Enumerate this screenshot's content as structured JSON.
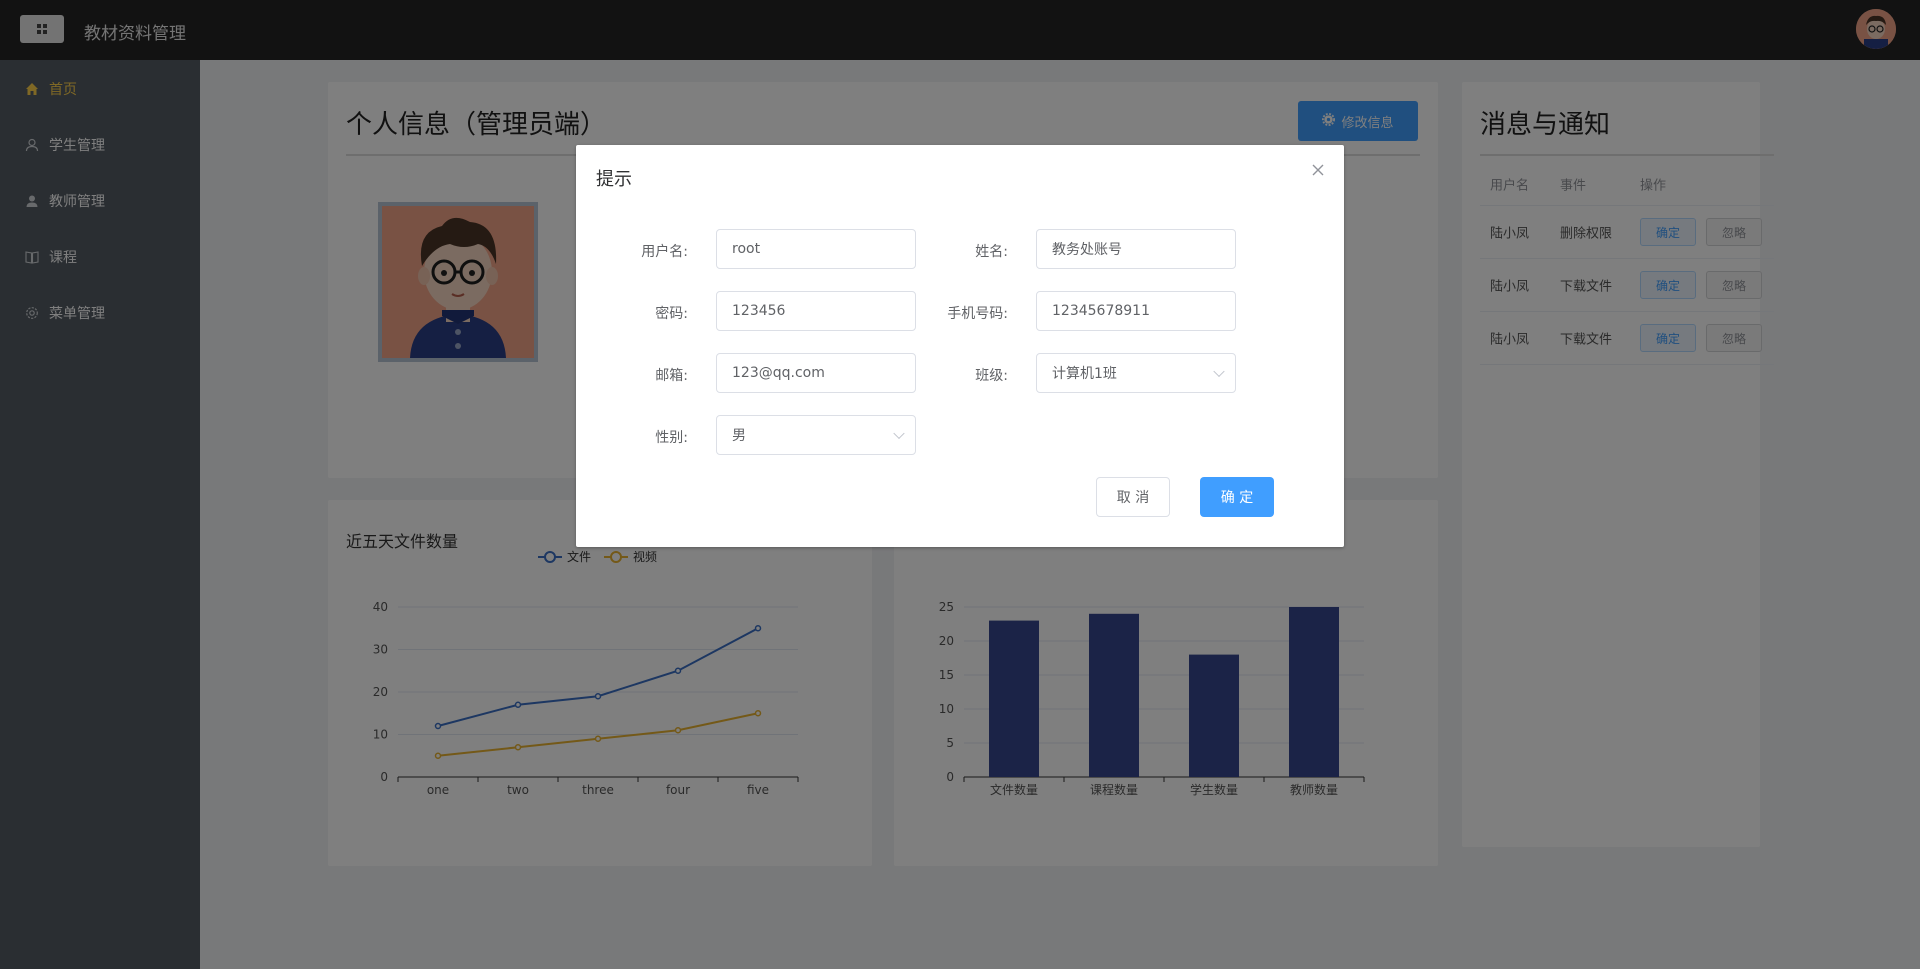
{
  "app": {
    "title": "教材资料管理"
  },
  "sidebar": {
    "items": [
      {
        "label": "首页",
        "icon": "home-icon",
        "active": true
      },
      {
        "label": "学生管理",
        "icon": "user-icon",
        "active": false
      },
      {
        "label": "教师管理",
        "icon": "user-filled-icon",
        "active": false
      },
      {
        "label": "课程",
        "icon": "book-icon",
        "active": false
      },
      {
        "label": "菜单管理",
        "icon": "gear-icon",
        "active": false
      }
    ]
  },
  "profile": {
    "title": "个人信息（管理员端）",
    "edit_button": "修改信息"
  },
  "notice": {
    "title": "消息与通知",
    "columns": [
      "用户名",
      "事件",
      "操作"
    ],
    "rows": [
      {
        "user": "陆小凤",
        "event": "删除权限",
        "confirm": "确定",
        "ignore": "忽略"
      },
      {
        "user": "陆小凤",
        "event": "下载文件",
        "confirm": "确定",
        "ignore": "忽略"
      },
      {
        "user": "陆小凤",
        "event": "下载文件",
        "confirm": "确定",
        "ignore": "忽略"
      }
    ]
  },
  "colors": {
    "accent": "#409eff",
    "sidebar_bg": "#545c64",
    "active_menu": "#ffd04b",
    "line_file": "#3a6fc4",
    "line_video": "#e8b231",
    "bar": "#36478f"
  },
  "chart_data": [
    {
      "type": "line",
      "title": "近五天文件数量",
      "categories": [
        "one",
        "two",
        "three",
        "four",
        "five"
      ],
      "series": [
        {
          "name": "文件",
          "values": [
            12,
            17,
            19,
            25,
            35
          ]
        },
        {
          "name": "视频",
          "values": [
            5,
            7,
            9,
            11,
            15
          ]
        }
      ],
      "ylim": [
        0,
        40
      ],
      "yticks": [
        0,
        10,
        20,
        30,
        40
      ],
      "legend": "top"
    },
    {
      "type": "bar",
      "categories": [
        "文件数量",
        "课程数量",
        "学生数量",
        "教师数量"
      ],
      "values": [
        23,
        24,
        18,
        25
      ],
      "ylim": [
        0,
        25
      ],
      "yticks": [
        0,
        5,
        10,
        15,
        20,
        25
      ]
    }
  ],
  "dialog": {
    "title": "提示",
    "fields": {
      "username": {
        "label": "用户名:",
        "value": "root"
      },
      "name": {
        "label": "姓名:",
        "value": "教务处账号"
      },
      "password": {
        "label": "密码:",
        "value": "123456"
      },
      "phone": {
        "label": "手机号码:",
        "value": "12345678911"
      },
      "email": {
        "label": "邮箱:",
        "value": "123@qq.com"
      },
      "class": {
        "label": "班级:",
        "value": "计算机1班"
      },
      "gender": {
        "label": "性别:",
        "value": "男"
      }
    },
    "cancel": "取 消",
    "confirm": "确 定"
  }
}
